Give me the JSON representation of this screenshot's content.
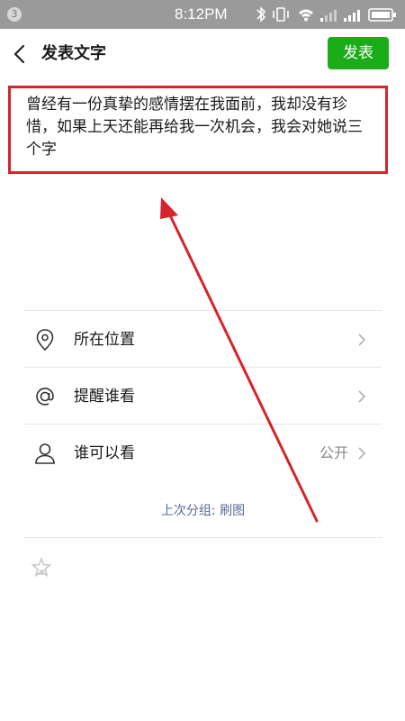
{
  "status_bar": {
    "notification_count": "3",
    "time": "8:12PM"
  },
  "header": {
    "title": "发表文字",
    "publish_label": "发表"
  },
  "composer": {
    "text": "曾经有一份真挚的感情摆在我面前，我却没有珍惜，如果上天还能再给我一次机会，我会对她说三个字"
  },
  "options": [
    {
      "label": "所在位置",
      "icon": "location-pin-icon",
      "value": ""
    },
    {
      "label": "提醒谁看",
      "icon": "at-sign-icon",
      "value": ""
    },
    {
      "label": "谁可以看",
      "icon": "person-icon",
      "value": "公开"
    }
  ],
  "last_group": "上次分组: 刷图",
  "colors": {
    "accent": "#1aad19",
    "annotation": "#d7232a",
    "link": "#576b95"
  }
}
